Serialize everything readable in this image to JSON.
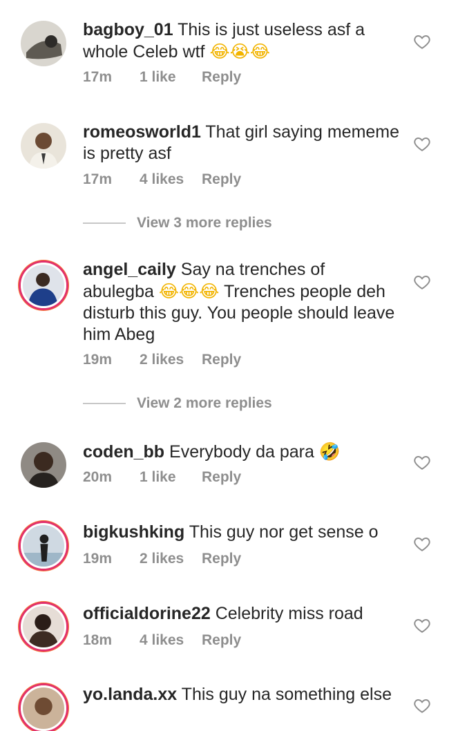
{
  "comments": [
    {
      "username": "bagboy_01",
      "text": "This is just useless asf a whole Celeb wtf",
      "emoji": "😂😭😂",
      "time": "17m",
      "likes": "1 like",
      "reply": "Reply"
    },
    {
      "username": "romeosworld1",
      "text": "That girl saying mememe is pretty asf",
      "time": "17m",
      "likes": "4 likes",
      "reply": "Reply"
    },
    {
      "username": "angel_caily",
      "text": "Say na trenches of abulegba",
      "emoji": "😂😂😂",
      "text2": "Trenches people deh disturb this guy. You people should leave him Abeg",
      "time": "19m",
      "likes": "2 likes",
      "reply": "Reply"
    },
    {
      "username": "coden_bb",
      "text": "Everybody da para",
      "emoji": "🤣",
      "time": "20m",
      "likes": "1 like",
      "reply": "Reply"
    },
    {
      "username": "bigkushking",
      "text": "This guy nor get sense o",
      "time": "19m",
      "likes": "2 likes",
      "reply": "Reply"
    },
    {
      "username": "officialdorine22",
      "text": "Celebrity miss road",
      "time": "18m",
      "likes": "4 likes",
      "reply": "Reply"
    },
    {
      "username": "yo.landa.xx",
      "text": "This guy na something else"
    }
  ],
  "more_replies": [
    "View 3 more replies",
    "View 2 more replies"
  ],
  "icons": {
    "heart": "heart-outline-icon"
  }
}
